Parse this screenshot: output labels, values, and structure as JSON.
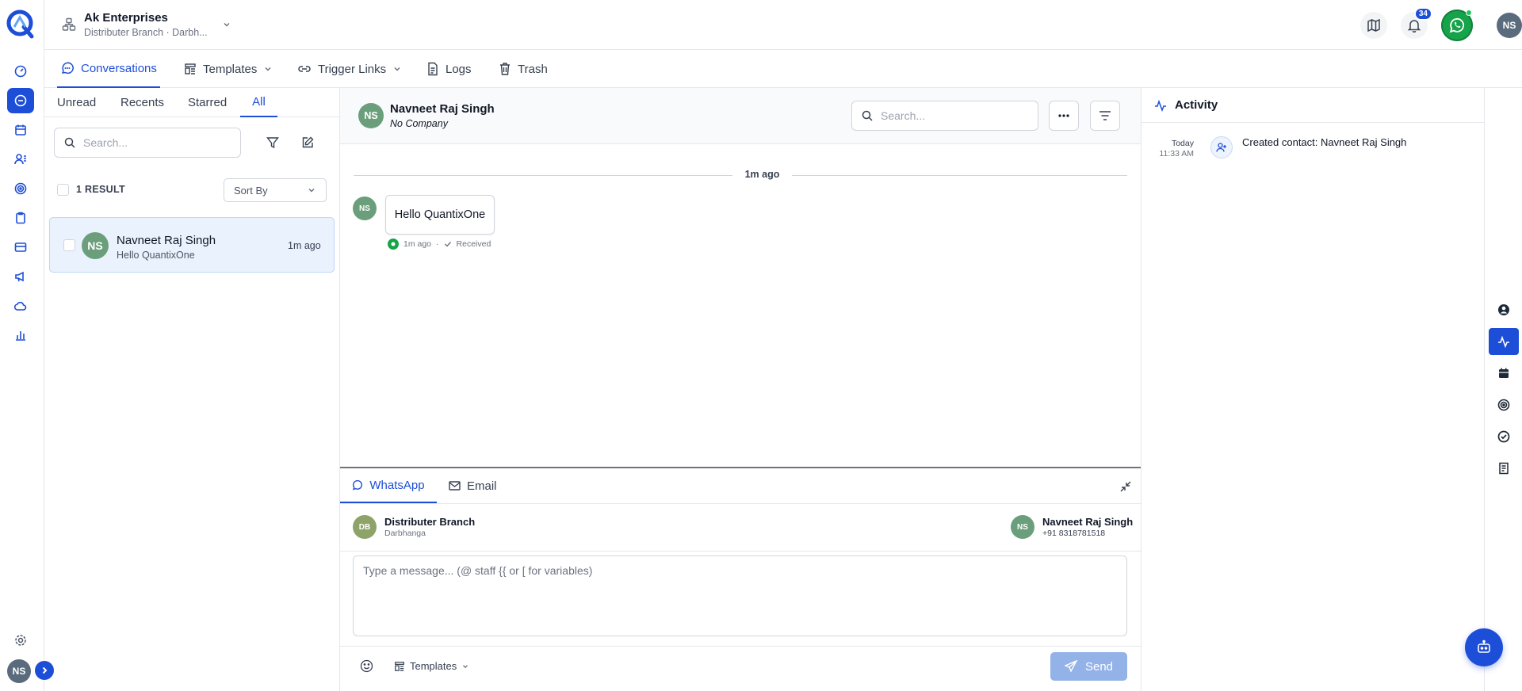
{
  "org": {
    "name": "Ak Enterprises",
    "branch": "Distributer Branch · Darbh..."
  },
  "header": {
    "notifications_count": "34",
    "user_initials": "NS"
  },
  "subnav": [
    {
      "label": "Conversations",
      "icon": "chat-bubble-icon"
    },
    {
      "label": "Templates",
      "icon": "template-icon"
    },
    {
      "label": "Trigger Links",
      "icon": "link-icon"
    },
    {
      "label": "Logs",
      "icon": "document-icon"
    },
    {
      "label": "Trash",
      "icon": "trash-icon"
    }
  ],
  "filters": {
    "tabs": [
      "Unread",
      "Recents",
      "Starred",
      "All"
    ],
    "active": "All"
  },
  "list": {
    "search_placeholder": "Search...",
    "result_count": "1 RESULT",
    "sort_label": "Sort By",
    "items": [
      {
        "initials": "NS",
        "name": "Navneet Raj Singh",
        "preview": "Hello QuantixOne",
        "time": "1m ago"
      }
    ]
  },
  "chat": {
    "contact_initials": "NS",
    "contact_name": "Navneet Raj Singh",
    "contact_company": "No Company",
    "search_placeholder": "Search...",
    "divider_label": "1m ago",
    "messages": [
      {
        "initials": "NS",
        "text": "Hello QuantixOne",
        "time": "1m ago",
        "status": "Received"
      }
    ]
  },
  "composer": {
    "tabs": [
      "WhatsApp",
      "Email"
    ],
    "from": {
      "initials": "DB",
      "name": "Distributer Branch",
      "sub": "Darbhanga"
    },
    "to": {
      "initials": "NS",
      "name": "Navneet Raj Singh",
      "phone": "+91 8318781518"
    },
    "placeholder": "Type a message... (@ staff  {{ or [ for variables)",
    "templates_label": "Templates",
    "send_label": "Send"
  },
  "activity": {
    "title": "Activity",
    "items": [
      {
        "date": "Today",
        "time": "11:33 AM",
        "text": "Created contact: Navneet Raj Singh"
      }
    ]
  },
  "colors": {
    "primary": "#1d4ed8",
    "whatsapp": "#16a34a",
    "avatar_green": "#6b9e7b",
    "avatar_olive": "#8ea36a"
  }
}
